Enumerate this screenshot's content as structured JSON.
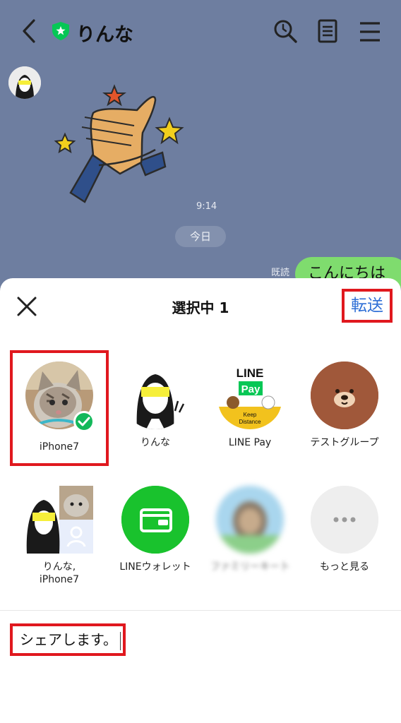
{
  "chat": {
    "contact_name": "りんな",
    "time": "9:14",
    "date_divider": "今日",
    "read_label": "既読",
    "last_message": "こんにちは"
  },
  "share_sheet": {
    "title": "選択中 1",
    "forward_label": "転送",
    "targets": [
      {
        "label": "iPhone7",
        "selected": true
      },
      {
        "label": "りんな"
      },
      {
        "label": "LINE Pay"
      },
      {
        "label": "テストグループ"
      },
      {
        "label": "りんな,\niPhone7"
      },
      {
        "label": "LINEウォレット"
      },
      {
        "label": "ファミリーキー卜"
      },
      {
        "label": "もっと見る"
      }
    ],
    "linepay_logo": {
      "line": "LINE",
      "pay": "Pay",
      "tagline1": "Keep",
      "tagline2": "Distance"
    },
    "message_value": "シェアします。"
  },
  "colors": {
    "chat_bg": "#6e7ea0",
    "line_green": "#06c755",
    "highlight_red": "#e0181e",
    "forward_blue": "#2f6fd6",
    "bubble_green": "#7fdc6e"
  }
}
